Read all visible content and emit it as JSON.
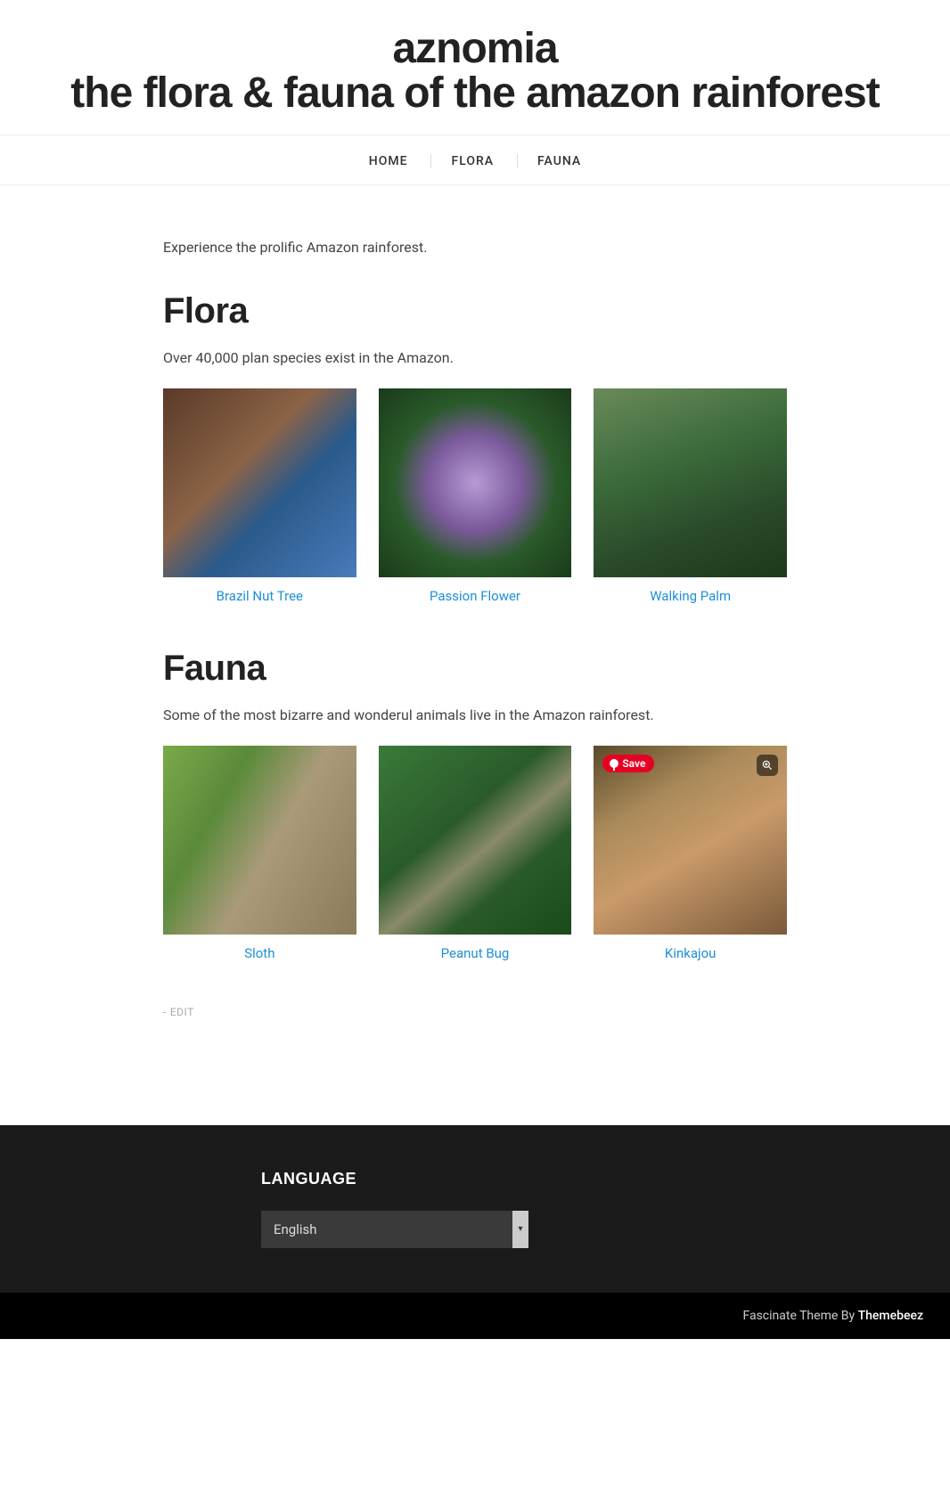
{
  "site": {
    "title_line1": "aznomia",
    "title_line2": "the flora & fauna of the amazon rainforest"
  },
  "nav": {
    "items": [
      {
        "label": "HOME"
      },
      {
        "label": "FLORA"
      },
      {
        "label": "FAUNA"
      }
    ]
  },
  "intro": "Experience the prolific Amazon rainforest.",
  "flora": {
    "heading": "Flora",
    "description": "Over 40,000 plan species exist in the Amazon.",
    "items": [
      {
        "caption": "Brazil Nut Tree"
      },
      {
        "caption": "Passion Flower"
      },
      {
        "caption": "Walking Palm"
      }
    ]
  },
  "fauna": {
    "heading": "Fauna",
    "description": "Some of the most bizarre and wonderul animals live in the Amazon rainforest.",
    "items": [
      {
        "caption": "Sloth"
      },
      {
        "caption": "Peanut Bug"
      },
      {
        "caption": "Kinkajou"
      }
    ]
  },
  "overlay": {
    "save_label": "Save"
  },
  "edit": {
    "dash": "-",
    "label": "EDIT"
  },
  "footer": {
    "language_heading": "LANGUAGE",
    "language_selected": "English",
    "theme_prefix": "Fascinate Theme By ",
    "theme_brand": "Themebeez"
  }
}
